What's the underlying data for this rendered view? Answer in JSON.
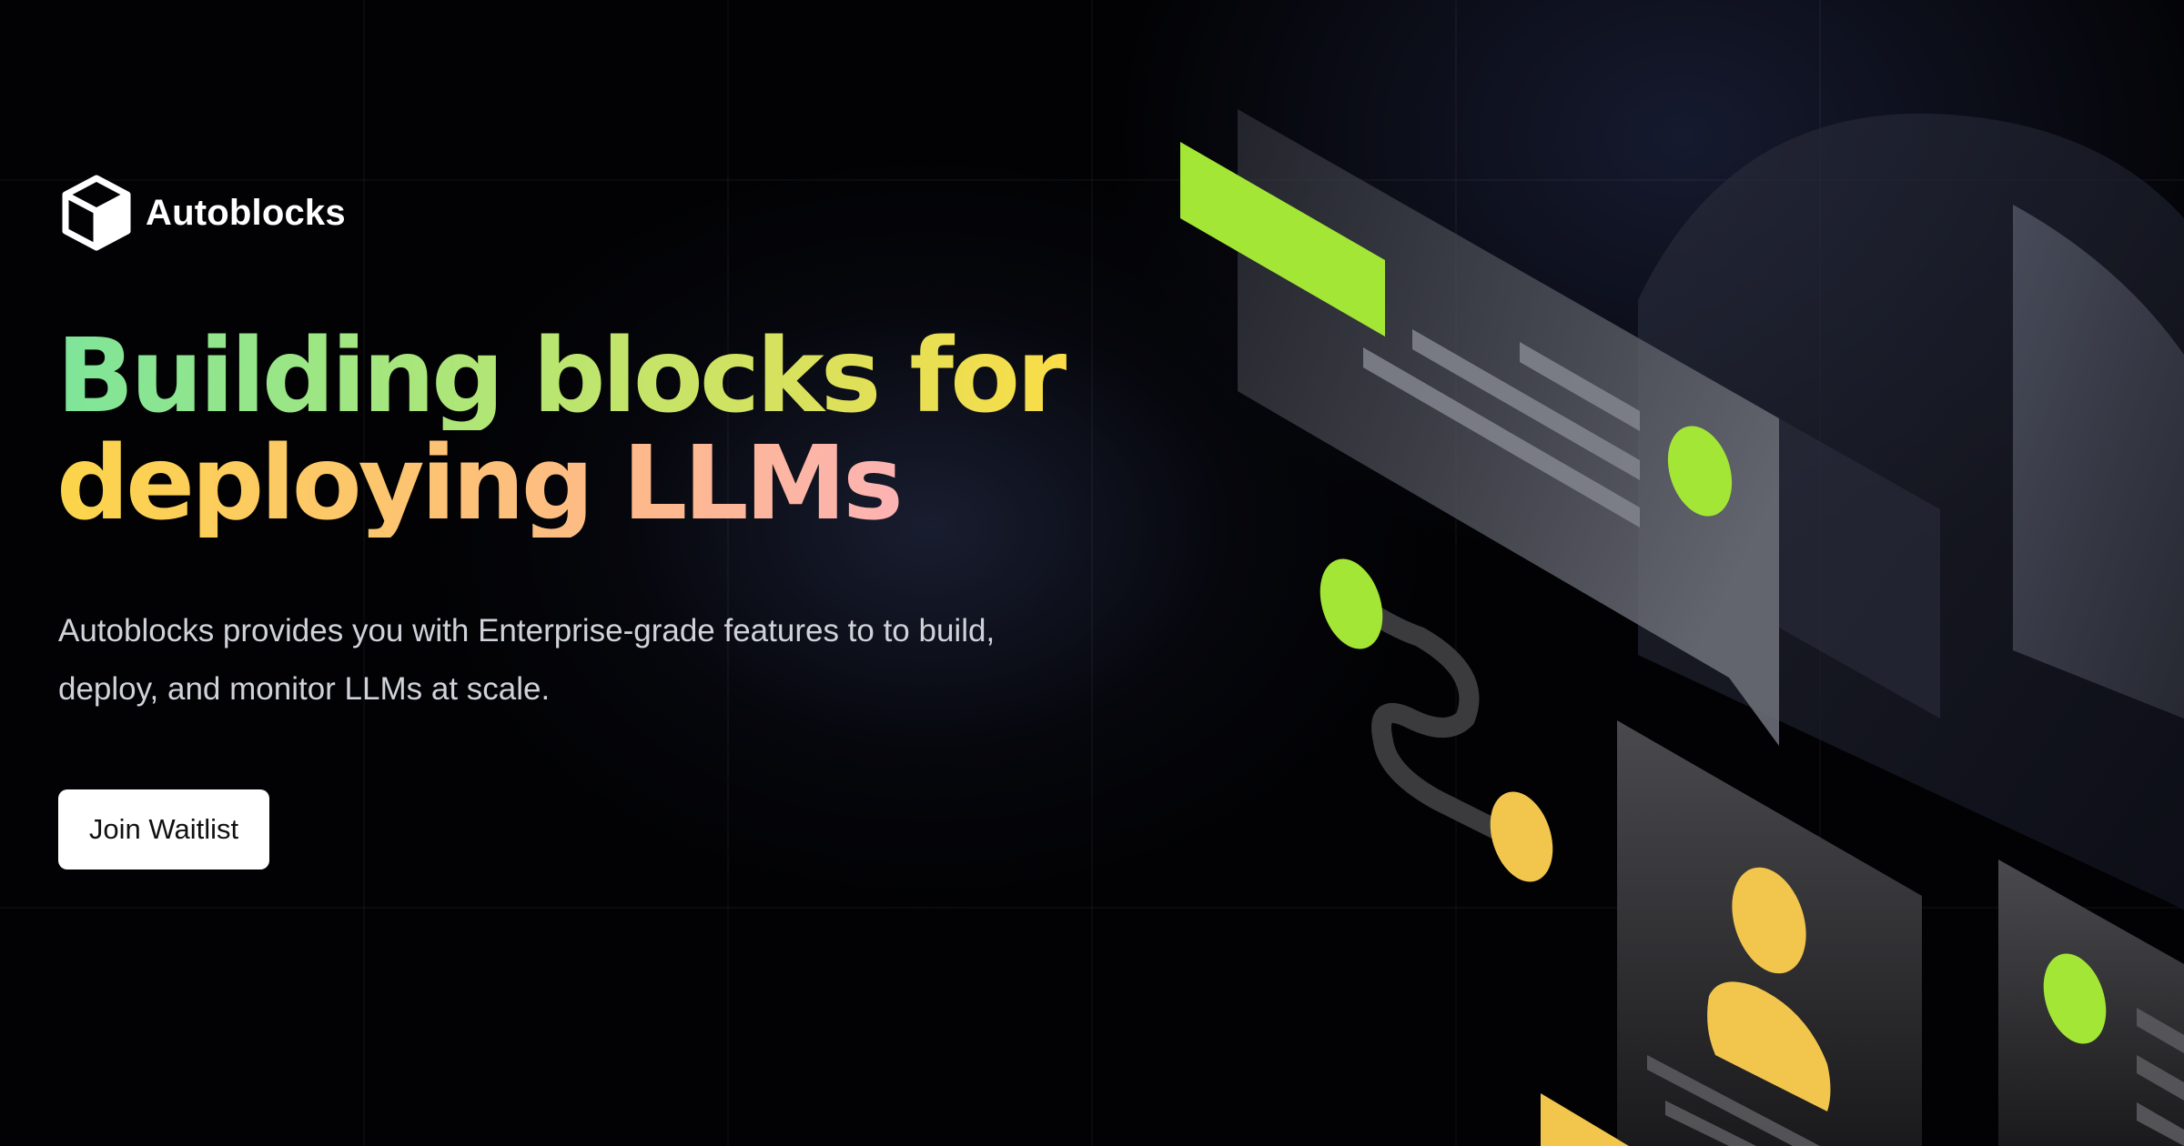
{
  "brand": {
    "name": "Autoblocks",
    "logo_icon": "cube-icon"
  },
  "hero": {
    "headline_line1": "Building blocks for",
    "headline_line2": "deploying LLMs",
    "subtitle": "Autoblocks provides you with Enterprise-grade features to to build, deploy, and monitor LLMs at scale.",
    "cta_label": "Join Waitlist"
  },
  "colors": {
    "background": "#020204",
    "accent_green": "#a4e635",
    "accent_yellow": "#f2c64c",
    "gradient_start": "#7ee59a",
    "gradient_mid": "#ffdc45",
    "gradient_end": "#fbaed3",
    "button_bg": "#ffffff"
  },
  "illustration": {
    "icons": [
      "chat-window-icon",
      "connector-path-icon",
      "user-profile-card-icon",
      "document-card-icon"
    ]
  }
}
